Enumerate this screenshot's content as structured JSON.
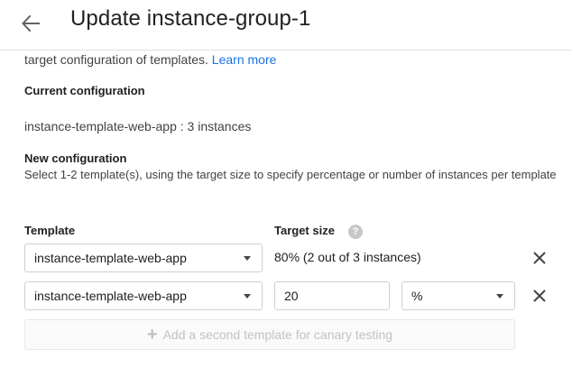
{
  "header": {
    "title": "Update instance-group-1"
  },
  "intro": {
    "text": "target configuration of templates. ",
    "link": "Learn more"
  },
  "current_config": {
    "label": "Current configuration",
    "value": "instance-template-web-app : 3 instances"
  },
  "new_config": {
    "label": "New configuration",
    "help": "Select 1-2 template(s), using the target size to specify percentage or number of instances per template"
  },
  "columns": {
    "template": "Template",
    "target_size": "Target size"
  },
  "rows": [
    {
      "template": "instance-template-web-app",
      "target_text": "80% (2 out of 3 instances)"
    },
    {
      "template": "instance-template-web-app",
      "target_value": "20",
      "unit": "%"
    }
  ],
  "add_button": {
    "label": "Add a second template for canary testing",
    "enabled": false
  },
  "icons": {
    "back": "arrow-back-icon",
    "help": "help-icon",
    "remove": "close-icon",
    "dropdown": "chevron-down-icon",
    "add": "plus-icon"
  },
  "colors": {
    "link": "#1a73e8",
    "disabled_text": "#c2c2c2"
  }
}
